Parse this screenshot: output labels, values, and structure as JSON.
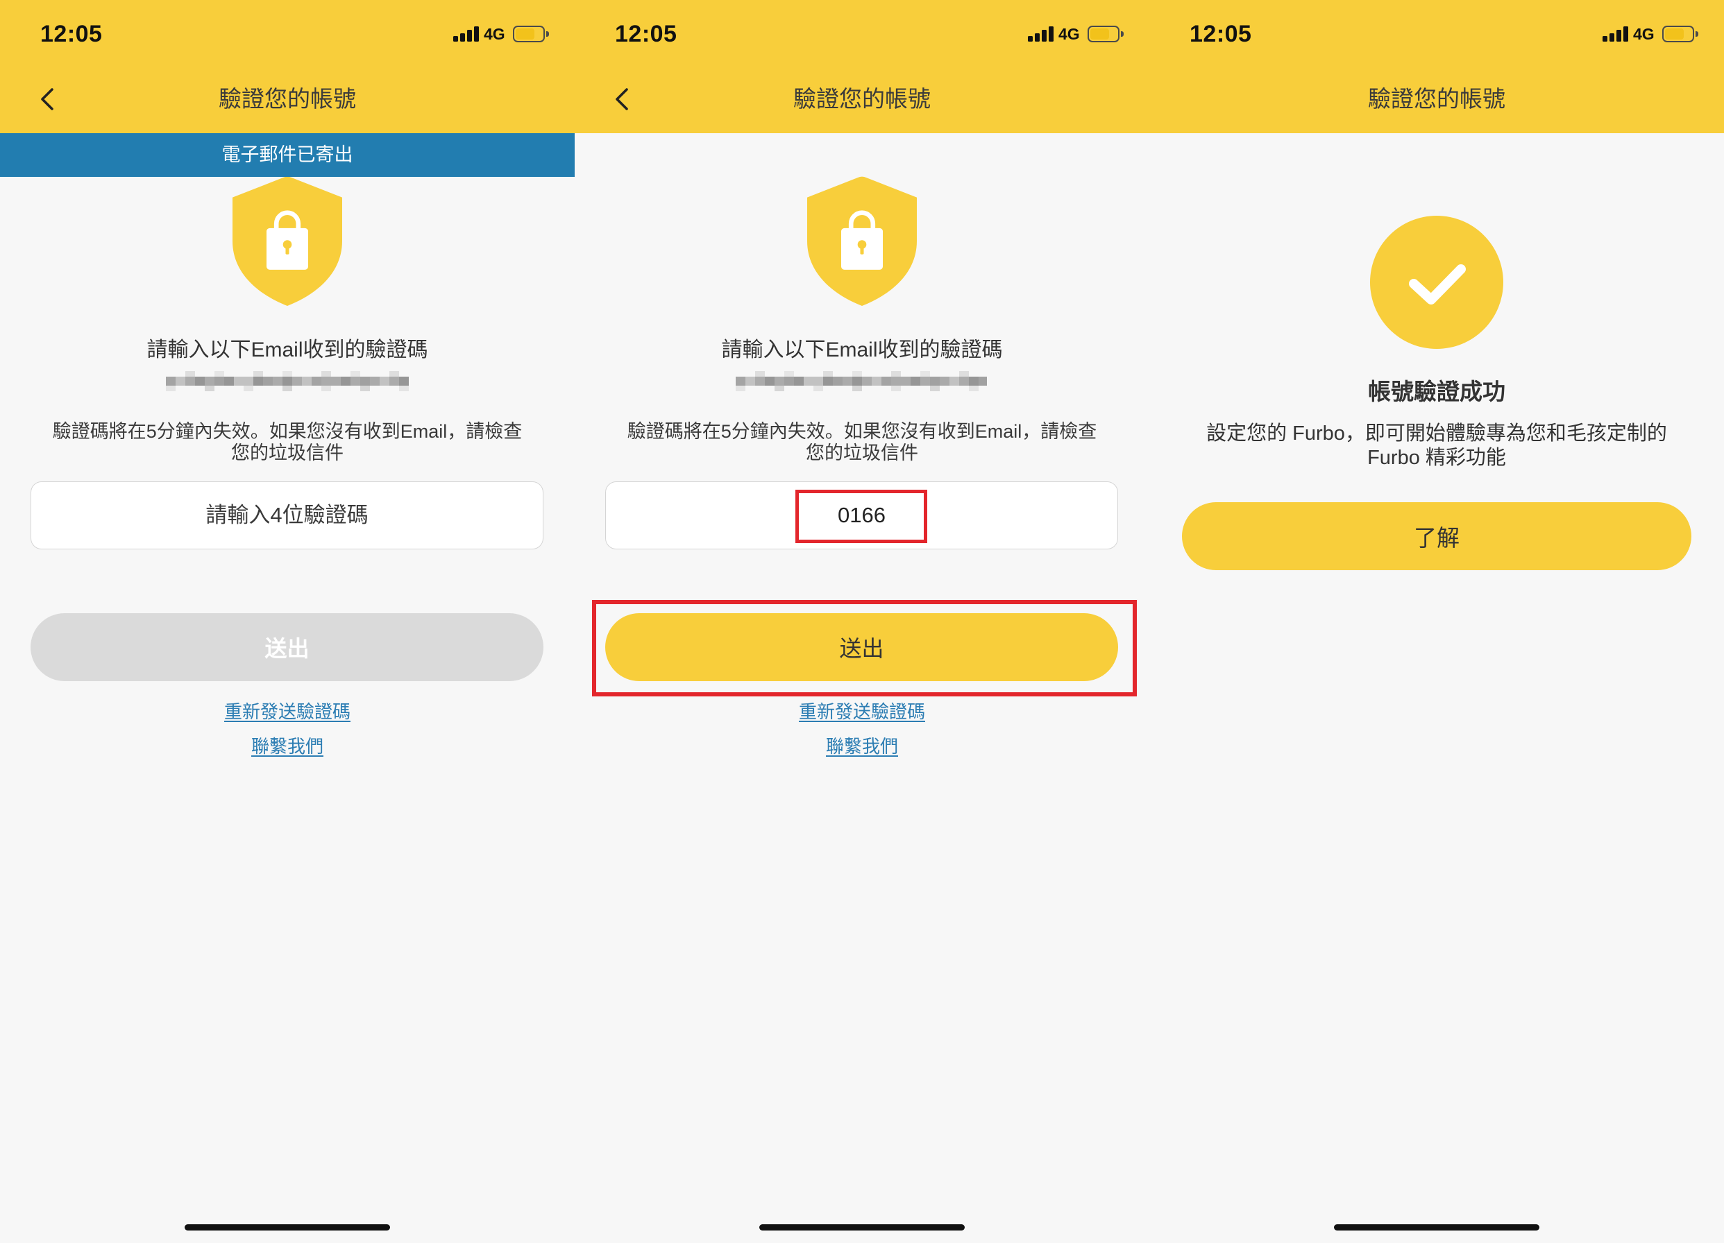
{
  "status_bar": {
    "time": "12:05",
    "network": "4G",
    "battery_level": 0.7,
    "signal_icon": "signal-bars-icon",
    "battery_icon": "battery-icon"
  },
  "colors": {
    "brand_yellow": "#F8CE3B",
    "banner_blue": "#227DB0",
    "link_blue": "#2C7DB3",
    "highlight_red": "#E3262C",
    "disabled_gray": "#DADADA",
    "page_background": "#F7F7F7",
    "text_dark": "#333333"
  },
  "screens": [
    {
      "header": {
        "title": "驗證您的帳號",
        "back_icon": "chevron-left-icon"
      },
      "banner": "電子郵件已寄出",
      "hero_icon": "shield-lock-icon",
      "prompt": "請輸入以下Email收到的驗證碼",
      "expiry_note": [
        "驗證碼將在5分鐘內失效。如果您沒有收到Email，請檢查",
        "您的垃圾信件"
      ],
      "code_input": {
        "placeholder": "請輸入4位驗證碼"
      },
      "submit": {
        "label": "送出",
        "enabled": false
      },
      "resend_link": "重新發送驗證碼",
      "contact_link": "聯繫我們"
    },
    {
      "header": {
        "title": "驗證您的帳號",
        "back_icon": "chevron-left-icon"
      },
      "hero_icon": "shield-lock-icon",
      "prompt": "請輸入以下Email收到的驗證碼",
      "expiry_note": [
        "驗證碼將在5分鐘內失效。如果您沒有收到Email，請檢查",
        "您的垃圾信件"
      ],
      "code_input": {
        "value": "0166"
      },
      "submit": {
        "label": "送出",
        "enabled": true
      },
      "resend_link": "重新發送驗證碼",
      "contact_link": "聯繫我們"
    },
    {
      "header": {
        "title": "驗證您的帳號"
      },
      "hero_icon": "check-circle-icon",
      "heading": "帳號驗證成功",
      "description": [
        "設定您的 Furbo，即可開始體驗專為您和毛孩定制的",
        "Furbo 精彩功能"
      ],
      "confirm_label": "了解"
    }
  ]
}
